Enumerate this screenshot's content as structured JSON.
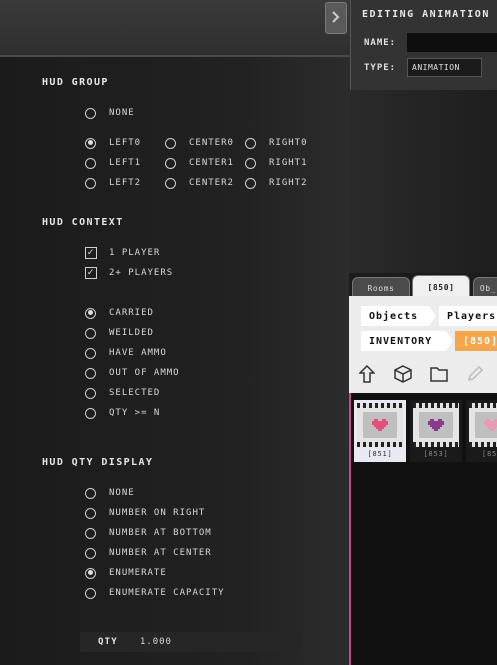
{
  "hud_group": {
    "heading": "HUD GROUP",
    "none": "NONE",
    "options": [
      [
        "LEFT0",
        "CENTER0",
        "RIGHT0"
      ],
      [
        "LEFT1",
        "CENTER1",
        "RIGHT1"
      ],
      [
        "LEFT2",
        "CENTER2",
        "RIGHT2"
      ]
    ],
    "selected": "LEFT0"
  },
  "hud_context": {
    "heading": "HUD CONTEXT",
    "checkboxes": [
      {
        "label": "1  PLAYER",
        "checked": true
      },
      {
        "label": "2+ PLAYERS",
        "checked": true
      }
    ],
    "options": [
      "CARRIED",
      "WEILDED",
      "HAVE AMMO",
      "OUT OF AMMO",
      "SELECTED",
      "QTY >= N"
    ],
    "selected": "CARRIED"
  },
  "hud_qty_display": {
    "heading": "HUD QTY DISPLAY",
    "options": [
      "NONE",
      "NUMBER ON RIGHT",
      "NUMBER AT BOTTOM",
      "NUMBER AT CENTER",
      "ENUMERATE",
      "ENUMERATE CAPACITY"
    ],
    "selected": "ENUMERATE"
  },
  "qty": {
    "label": "QTY",
    "value": "1.000"
  },
  "anim_editor": {
    "title": "EDITING ANIMATION",
    "name_label": "NAME:",
    "name_value": "",
    "type_label": "TYPE:",
    "type_value": "ANIMATION"
  },
  "resource_browser": {
    "tabs": [
      "Rooms",
      "[850]",
      "Ob_"
    ],
    "active_tab": "[850]",
    "breadcrumb_row1": [
      "Objects",
      "Players"
    ],
    "breadcrumb_row2": [
      "INVENTORY",
      "[850]"
    ],
    "tools": [
      "up-arrow-icon",
      "cube-icon",
      "folder-icon",
      "pencil-icon"
    ],
    "items": [
      {
        "label": "[851]",
        "heart_color": "#e0507a",
        "selected": true
      },
      {
        "label": "[853]",
        "heart_color": "#8a3a8a",
        "selected": false
      },
      {
        "label": "[85_",
        "heart_color": "#e79ab4",
        "selected": false
      }
    ]
  },
  "colors": {
    "accent_orange": "#f5a54a",
    "accent_pink": "#c24c85"
  }
}
